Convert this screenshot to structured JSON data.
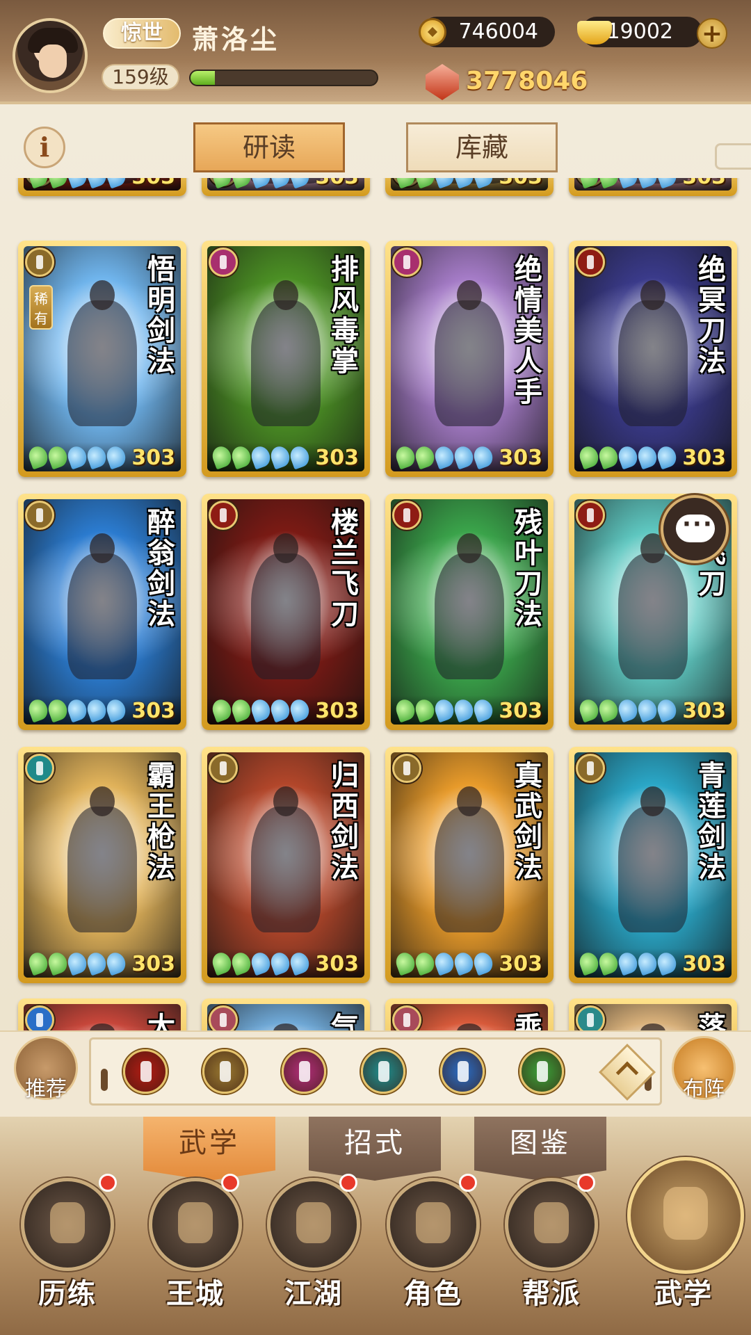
{
  "header": {
    "rank_title": "惊世",
    "player_name": "萧洛尘",
    "level": "159级",
    "xp_fraction": 0.13,
    "copper": "746004",
    "gold": "19002",
    "power": "3778046"
  },
  "tabs": {
    "study": "研读",
    "storage": "库藏"
  },
  "card_level": "303",
  "top_row": [
    {
      "name": "",
      "color": "#b22a1a",
      "type": "#8e1c14"
    },
    {
      "name": "",
      "color": "#e7b0d2",
      "type": "#a82f6e"
    },
    {
      "name": "",
      "color": "#d8b25a",
      "type": "#8a6a2a"
    },
    {
      "name": "",
      "color": "#f0a7b6",
      "type": "#a82f6e"
    }
  ],
  "cards": [
    {
      "name": "悟明剑法",
      "color": "#6fb4ec",
      "type": "#8a6a2a",
      "rare": "稀有"
    },
    {
      "name": "排风毒掌",
      "color": "#4b8f24",
      "type": "#a82f6e",
      "rare": ""
    },
    {
      "name": "绝情美人手",
      "color": "#a47bc6",
      "type": "#a82f6e",
      "rare": ""
    },
    {
      "name": "绝冥刀法",
      "color": "#3a3a8a",
      "type": "#8e1c14",
      "rare": ""
    },
    {
      "name": "醉翁剑法",
      "color": "#2b7bcf",
      "type": "#8a6a2a",
      "rare": ""
    },
    {
      "name": "楼兰飞刀",
      "color": "#7a1a14",
      "type": "#8e1c14",
      "rare": ""
    },
    {
      "name": "残叶刀法",
      "color": "#3aa34a",
      "type": "#8e1c14",
      "rare": ""
    },
    {
      "name": "月飞刀",
      "color": "#5ec7c0",
      "type": "#8e1c14",
      "rare": ""
    },
    {
      "name": "霸王枪法",
      "color": "#e0b25a",
      "type": "#1f8a8a",
      "rare": ""
    },
    {
      "name": "归西剑法",
      "color": "#b2462a",
      "type": "#8a6a2a",
      "rare": ""
    },
    {
      "name": "真武剑法",
      "color": "#e79a2a",
      "type": "#8a6a2a",
      "rare": ""
    },
    {
      "name": "青莲剑法",
      "color": "#2aa6c6",
      "type": "#8a6a2a",
      "rare": ""
    }
  ],
  "bottom_row": [
    {
      "name": "太",
      "color": "#c7463a",
      "type": "#2a6ec7"
    },
    {
      "name": "气",
      "color": "#6fa8d6",
      "type": "#a84a5a"
    },
    {
      "name": "乘",
      "color": "#d85a3a",
      "type": "#a84a5a"
    },
    {
      "name": "落",
      "color": "#d8b07a",
      "type": "#2a8a8a"
    }
  ],
  "filters": {
    "recommend": "推荐",
    "formation": "布阵",
    "icons": [
      {
        "name": "blade-type-icon",
        "color": "#b21c14"
      },
      {
        "name": "sword-type-icon",
        "color": "#9a7a32"
      },
      {
        "name": "palm-type-icon",
        "color": "#b22f7a"
      },
      {
        "name": "fan-type-icon",
        "color": "#1f8f8f"
      },
      {
        "name": "taiji-type-icon",
        "color": "#2a6ec7"
      },
      {
        "name": "whirl-type-icon",
        "color": "#3aa33a"
      }
    ]
  },
  "subtabs": [
    "武学",
    "招式",
    "图鉴"
  ],
  "nav": [
    "历练",
    "王城",
    "江湖",
    "角色",
    "帮派",
    "武学"
  ]
}
